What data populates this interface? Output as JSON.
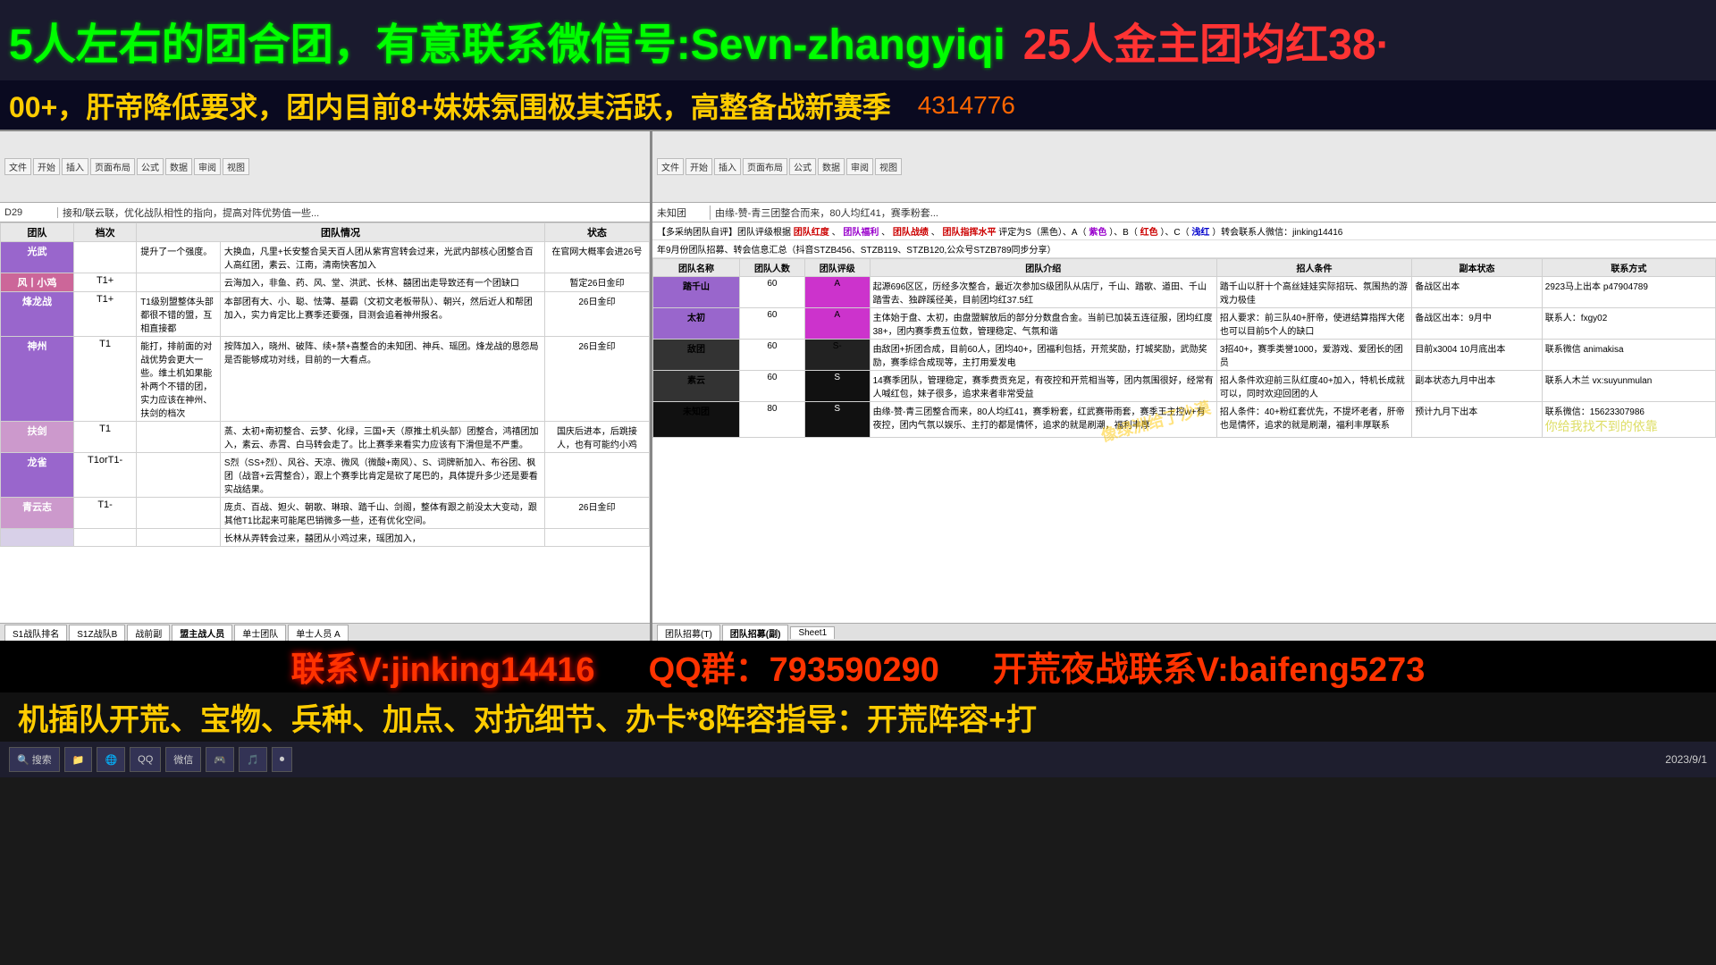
{
  "top_banner": {
    "text1": "5人左右的团合团，有意联系微信号:Sevn-zhangyiqi",
    "text2": "25人金主团均红38·",
    "text3": "00+，肝帝降低要求，团内目前8+妹妹氛围极其活跃，高整备战新赛季",
    "text4": "4314776"
  },
  "excel_left": {
    "formula_bar": {
      "cell_ref": "D29",
      "formula": "接和/联云联，优化战队相性的指向，提高对阵优势值一些..."
    },
    "rows": [
      {
        "name": "光武",
        "tier": "",
        "pre": "提升了一个强度。",
        "desc": "大换血，凡里+长安整合吴天百人团从紫宵宫转会过来，光武内部核心团整合百人高红团，素云、江南，清南快客加入",
        "status": "在官网大概率会进26号"
      },
      {
        "name": "风丨小鸡",
        "tier": "T1+",
        "pre": "",
        "desc": "云海加入，非鱼、药、风、堂、洪武、长林、囍团出走导致还有一个团缺口",
        "status": "暂定26日金印"
      },
      {
        "name": "烽龙战",
        "tier": "T1+",
        "pre": "T1级别盟整体头部都很不错的盟，互相直接都",
        "desc": "本部团有大、小、聪、怯薄、基霸（文初文老板带队）、朝兴，然后近人和帮团加入，实力肯定比上赛季还要强，目测会追着神州报名。",
        "status": "26日金印"
      },
      {
        "name": "神州",
        "tier": "T1",
        "pre": "能打，排前面的对战优势会更大一些。维土机如果能补两个不错的团，实力应该在神州、扶剑的档次",
        "desc": "按阵加入，晓州、破阵、续+禁+喜整合的未知团、神兵、瑶团。烽龙战的恩怨局是否能够成功对线，目前的一大看点。",
        "status": "26日金印"
      },
      {
        "name": "扶剑",
        "tier": "T1",
        "pre": "",
        "desc": "蒸、太初+南初整合、云梦、化绿，三国+天（原推土机头部）团整合，鸿禧团加入，素云、赤霄、白马转会走了。比上赛季来看实力应该有下滑但是不严重。",
        "status": "国庆后进本，后跳接人，也有可能约小鸡"
      },
      {
        "name": "龙雀",
        "tier": "T1orT1-",
        "pre": "",
        "desc": "S烈（SS+烈）、风谷、天凉、微风（微酸+南风）、S、词牌新加入、布谷团、枫团（战音+云霄整合），跟上个赛季比肯定是砍了尾巴的，具体提升多少还是要看实战结果。",
        "status": ""
      },
      {
        "name": "青云志",
        "tier": "T1-",
        "pre": "",
        "desc": "庞贞、百战、妲火、朝歌、琳琅、踏千山、剑阁，整体有跟之前没太大变动，跟其他T1比起来可能尾巴销微多一些，还有优化空间。",
        "status": "26日金印"
      },
      {
        "name": "",
        "tier": "",
        "pre": "",
        "desc": "长林从弄转会过来，囍团从小鸡过来，瑶团加入，",
        "status": ""
      }
    ]
  },
  "excel_right": {
    "header1": "多采纳团队自评】团队评级根据团队红度、团队福利、团队战绩、团队指挥水平评定为S（黑色）、A（紫色）、B（红色）、C（浅红）转会联系人微信：jinking14416",
    "header2": "年9月份团队招募、转会信息汇总（抖音STZB456、STZB119、STZB120,公众号STZB789同步分享）",
    "columns": [
      "团队名称",
      "团队人数",
      "团队评级",
      "团队介绍",
      "招人条件",
      "副本状态",
      "联系方式"
    ],
    "rows": [
      {
        "name": "踏千山",
        "count": "60",
        "grade": "A",
        "grade_style": "a",
        "intro": "起源696区区，历经多次整合，最近次参加S级团队从店厅，千山、踏歌、道田、千山踏雪去、独辟蹊径美，目前团均红37.5红",
        "recruit": "踏千山以肝十个高丝娃娃实际招玩、氛围热的游戏力极佳",
        "state": "备战区出本",
        "contact": "2923马上出本 p47904789"
      },
      {
        "name": "太初",
        "count": "60",
        "grade": "A",
        "grade_style": "a",
        "intro": "主体始于盘、太初，由盘盟解放后的部分分数盘合金。当前已加装五连征服，团均红度38+，团内赛季费五位数，管理稳定、气氛和谐",
        "recruit": "招人要求：前三队40+肝帝，使进结算指挥大佬也可以目前5个人的缺口",
        "state": "备战区出本：9月中",
        "contact": "联系人：fxgy02"
      },
      {
        "name": "敌团",
        "count": "60",
        "grade": "S-",
        "grade_style": "s-",
        "intro": "由敌团+折团合成，目前60人，团均40+，团福利包括，开荒奖励，打城奖励，武勋奖励，赛季综合成现等，主打用爱发电",
        "recruit": "3招40+，赛季类誉1000，爱游戏、爱团长的团员",
        "state": "目前x3004 10月底出本",
        "contact": "联系微信 animakisa"
      },
      {
        "name": "素云",
        "count": "60",
        "grade": "S",
        "grade_style": "s",
        "intro": "14赛季团队，管理稳定，赛季费贡充足，有夜控和开荒相当等，团内氛围很好，经常有人喊红包，妹子很多，追求来者非常受益",
        "recruit": "招人条件欢迎前三队红度40+加入，特机长成就可以，同时欢迎回团的人",
        "state": "副本状态九月中出本",
        "contact": "联系人木兰 vx:suyunmulan"
      },
      {
        "name": "未知团",
        "count": "80",
        "grade": "S",
        "grade_style": "s",
        "intro": "由缘-赞-青三团整合而来，80人均红41，赛季粉套，红武赛带雨套，赛季王主控w+有夜控，团内气氛以娱乐、主打的都是情怀，追求的就是刷潮，福利丰厚，联系",
        "recruit": "招人条件：40+粉红套优先，不提坏老者，肝帝也是情怀，追求的就是刷潮，福利丰厚联系",
        "state": "预计九月下出本",
        "contact": "联系微信：15623307986 预计九月下出 像绿洲给了沙漠"
      }
    ]
  },
  "bottom_banner": {
    "contact": "联系V:jinking14416",
    "qq": "QQ群：793590290",
    "night": "开荒夜战联系V:baifeng5273"
  },
  "guide_banner": {
    "text": "机插队开荒、宝物、兵种、加点、对抗细节、办卡*8阵容指导：开荒阵容+打"
  },
  "taskbar": {
    "time": "2023/9/1",
    "buttons": [
      "搜索",
      "文件",
      "浏览器",
      "QQ",
      "微信",
      "游戏",
      "音乐",
      "录屏"
    ]
  }
}
